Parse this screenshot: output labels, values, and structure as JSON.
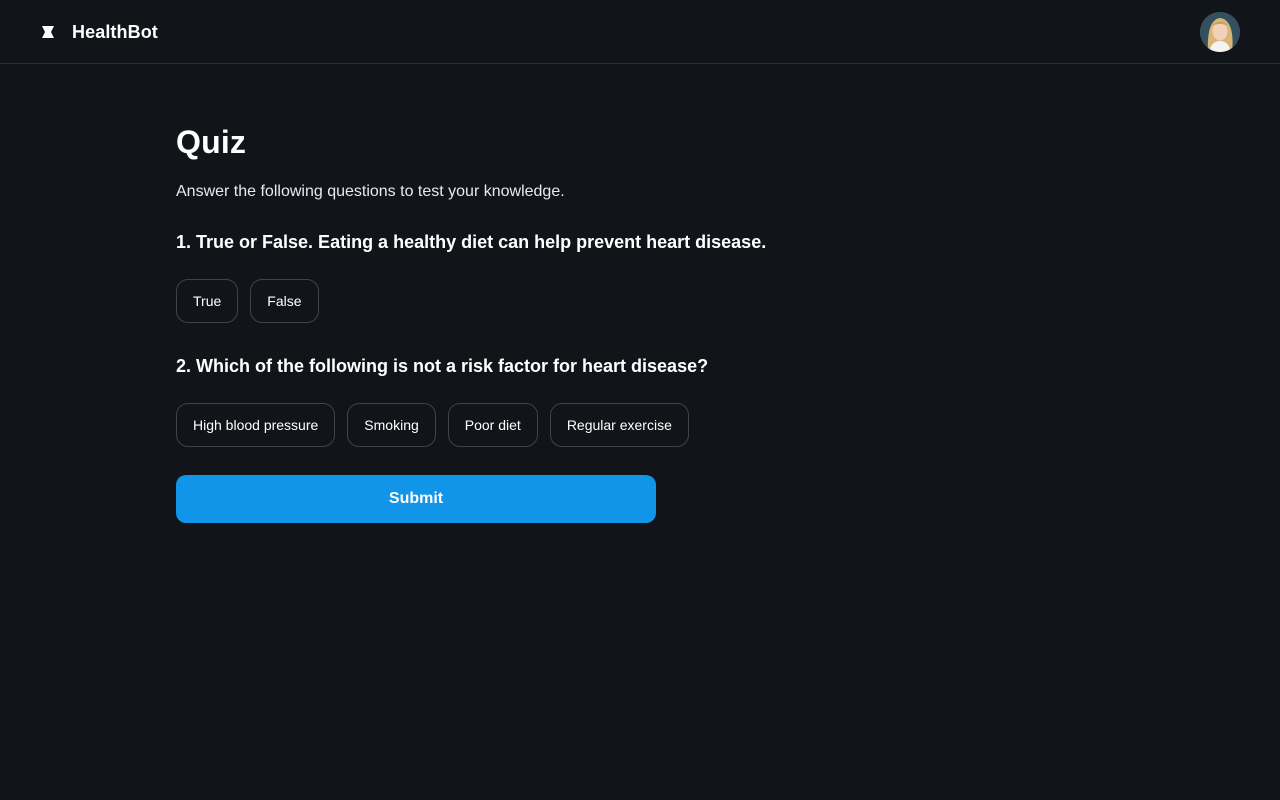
{
  "header": {
    "app_title": "HealthBot",
    "logo_icon": "logo-icon",
    "avatar_icon": "user-avatar"
  },
  "main": {
    "title": "Quiz",
    "intro": "Answer the following questions to test your knowledge.",
    "questions": [
      {
        "text": "1. True or False. Eating a healthy diet can help prevent heart disease.",
        "options": [
          "True",
          "False"
        ]
      },
      {
        "text": "2. Which of the following is not a risk factor for heart disease?",
        "options": [
          "High blood pressure",
          "Smoking",
          "Poor diet",
          "Regular exercise"
        ]
      }
    ],
    "submit_label": "Submit"
  },
  "colors": {
    "background": "#111519",
    "accent": "#1095e8",
    "border": "#3d444c"
  }
}
